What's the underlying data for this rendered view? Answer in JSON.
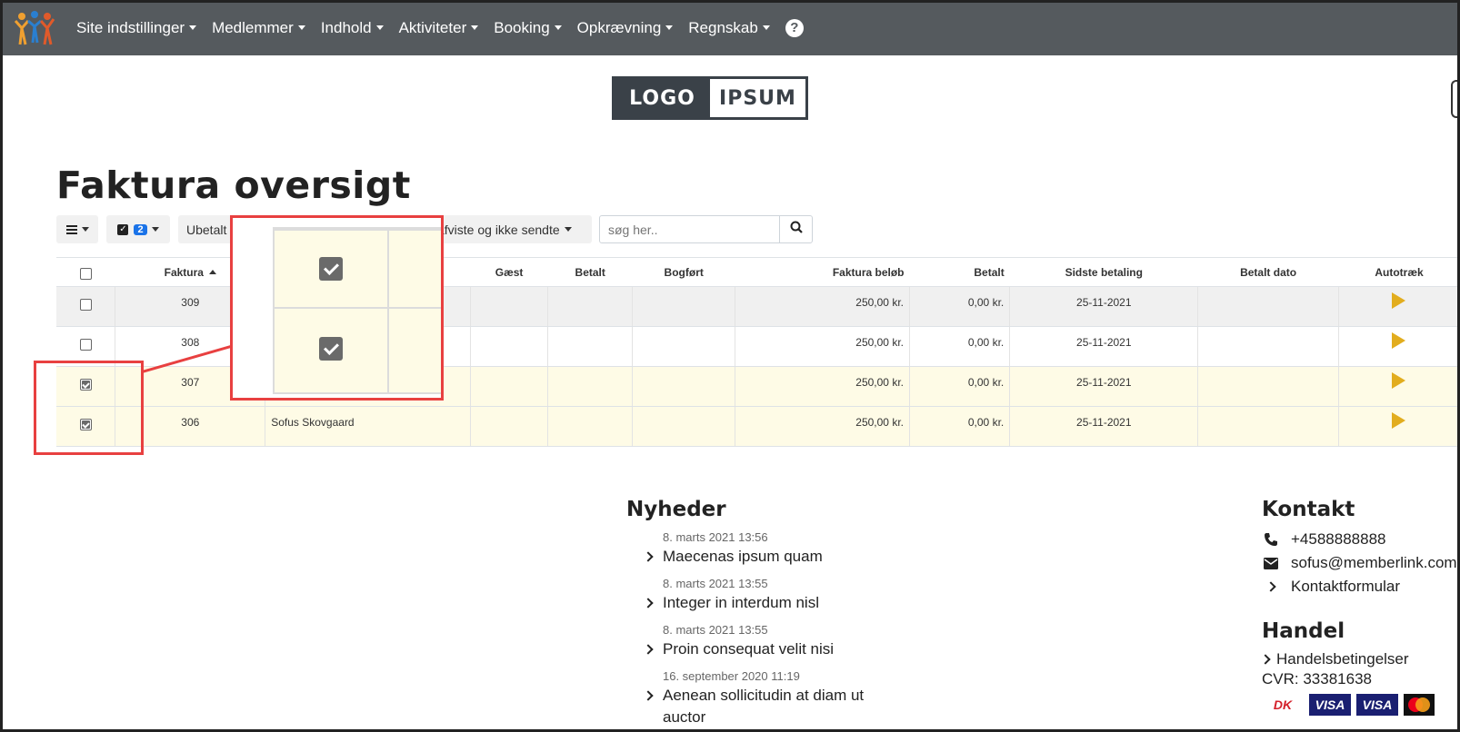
{
  "nav": {
    "items": [
      {
        "label": "Site indstillinger"
      },
      {
        "label": "Medlemmer"
      },
      {
        "label": "Indhold"
      },
      {
        "label": "Aktiviteter"
      },
      {
        "label": "Booking"
      },
      {
        "label": "Opkrævning"
      },
      {
        "label": "Regnskab"
      }
    ],
    "help_glyph": "?"
  },
  "logo": {
    "part1": "LOGO",
    "part2": "IPSUM"
  },
  "page_title": "Faktura oversigt",
  "toolbar": {
    "selected_count": "2",
    "status_filter": "Ubetalt",
    "status_filter_2": "afviste og ikke sendte",
    "search_placeholder": "søg her.."
  },
  "table": {
    "headers": [
      "Faktura",
      "Gæst",
      "Betalt",
      "Bogført",
      "Faktura beløb",
      "Betalt",
      "Sidste betaling",
      "Betalt dato",
      "Autotræk"
    ],
    "rows": [
      {
        "faktura": "309",
        "navn": "",
        "belob": "250,00 kr.",
        "betalt": "0,00 kr.",
        "sidste": "25-11-2021",
        "checked": false
      },
      {
        "faktura": "308",
        "navn": "",
        "belob": "250,00 kr.",
        "betalt": "0,00 kr.",
        "sidste": "25-11-2021",
        "checked": false
      },
      {
        "faktura": "307",
        "navn": "",
        "belob": "250,00 kr.",
        "betalt": "0,00 kr.",
        "sidste": "25-11-2021",
        "checked": true
      },
      {
        "faktura": "306",
        "navn": "Sofus Skovgaard",
        "belob": "250,00 kr.",
        "betalt": "0,00 kr.",
        "sidste": "25-11-2021",
        "checked": true
      }
    ]
  },
  "news": {
    "title": "Nyheder",
    "items": [
      {
        "date": "8. marts 2021 13:56",
        "title": "Maecenas ipsum quam"
      },
      {
        "date": "8. marts 2021 13:55",
        "title": "Integer in interdum nisl"
      },
      {
        "date": "8. marts 2021 13:55",
        "title": "Proin consequat velit nisi"
      },
      {
        "date": "16. september 2020 11:19",
        "title": "Aenean sollicitudin at diam ut auctor"
      }
    ]
  },
  "contact": {
    "title": "Kontakt",
    "phone": "+4588888888",
    "email": "sofus@memberlink.com",
    "form_link": "Kontaktformular"
  },
  "handel": {
    "title": "Handel",
    "terms_link": "Handelsbetingelser",
    "cvr": "CVR: 33381638",
    "cards": [
      "DK",
      "VISA",
      "VISA"
    ]
  },
  "colors": {
    "nav_bg": "#555a5e",
    "callout_red": "#e84040",
    "selected_row": "#fefbe6",
    "autotraek_play": "#e2ad1e",
    "badge_blue": "#1a73e8"
  }
}
